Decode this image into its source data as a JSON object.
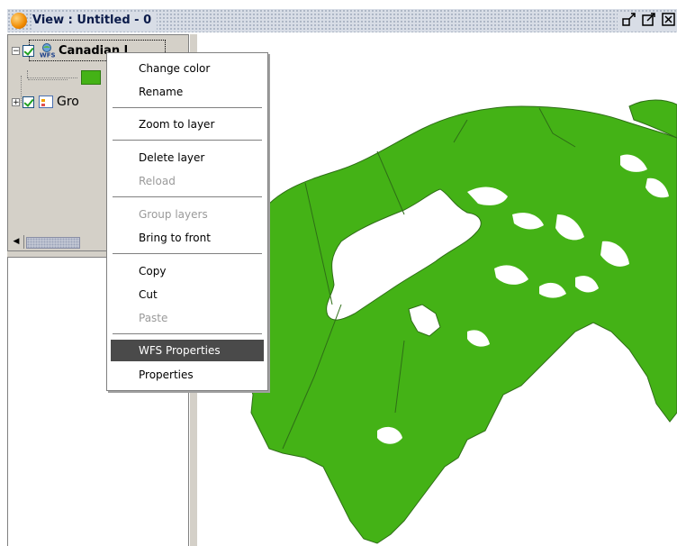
{
  "window": {
    "title": "View : Untitled - 0",
    "icon": "globe-icon",
    "buttons": [
      "minimize-icon",
      "maximize-icon",
      "close-icon"
    ]
  },
  "toc": {
    "layers": [
      {
        "label": "Canadian l",
        "icon": "wfs-layer-icon",
        "checked": true,
        "expanded": true,
        "legend_color": "#44b216"
      },
      {
        "label": "Gro",
        "icon": "group-layer-icon",
        "checked": true,
        "expanded": false
      }
    ]
  },
  "context_menu": {
    "items": [
      {
        "label": "Change color",
        "enabled": true
      },
      {
        "label": "Rename",
        "enabled": true
      },
      {
        "separator": true
      },
      {
        "label": "Zoom to layer",
        "enabled": true
      },
      {
        "separator": true
      },
      {
        "label": "Delete layer",
        "enabled": true
      },
      {
        "label": "Reload",
        "enabled": false
      },
      {
        "separator": true
      },
      {
        "label": "Group layers",
        "enabled": false
      },
      {
        "label": "Bring to front",
        "enabled": true
      },
      {
        "separator": true
      },
      {
        "label": "Copy",
        "enabled": true
      },
      {
        "label": "Cut",
        "enabled": true
      },
      {
        "label": "Paste",
        "enabled": false
      },
      {
        "separator": true
      },
      {
        "label": "WFS Properties",
        "enabled": true,
        "highlighted": true
      },
      {
        "label": "Properties",
        "enabled": true
      }
    ]
  },
  "colors": {
    "map_fill": "#44b216",
    "map_border": "#2e6e16",
    "menu_highlight": "#4a4a4a",
    "panel_bg": "#d4d0c8"
  }
}
